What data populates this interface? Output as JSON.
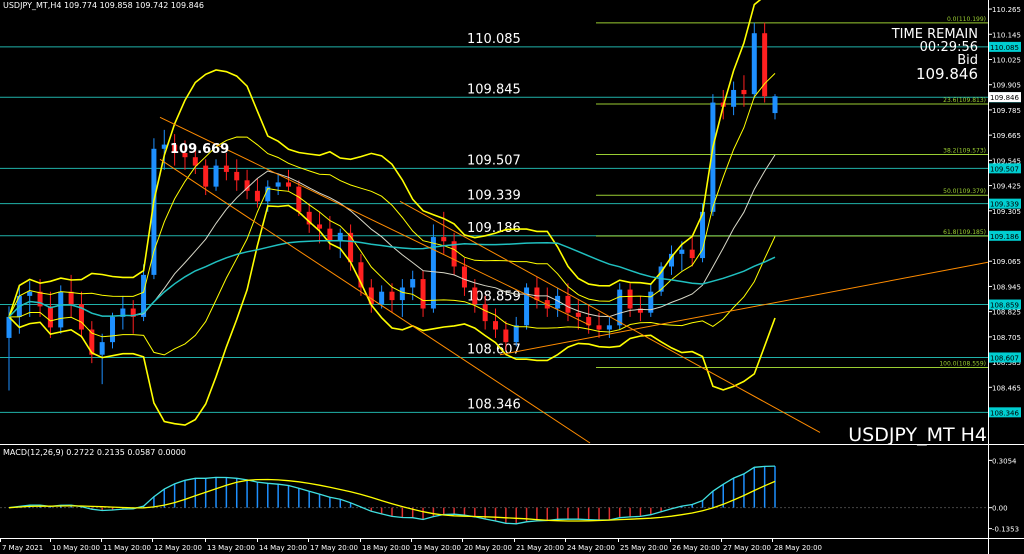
{
  "header": {
    "symbol_info": "USDJPY_MT,H4  109.774 109.858 109.742 109.846"
  },
  "overlay": {
    "time_remain_label": "TIME REMAIN",
    "time_remain_value": "00:29:56",
    "bid_label": "Bid",
    "bid_value": "109.846",
    "symbol_timeframe": "USDJPY_MT H4",
    "high_annotation": "109.669"
  },
  "macd": {
    "label": "MACD(12,26,9) 0.2722 0.2135 0.0587 0.0000",
    "axis_labels": [
      "0.3054",
      "0.00",
      "-0.1353"
    ],
    "axis_values": [
      0.3054,
      0.0,
      -0.1353
    ],
    "ylim": [
      -0.17,
      0.34
    ],
    "hist_color": "#1e90ff",
    "hist_neg_color": "#e03030",
    "signal_color": "#ffff00",
    "line_color": "#40e0e0"
  },
  "chart_data": {
    "type": "candlestick",
    "ylim": [
      108.2,
      110.27
    ],
    "price_axis_labels": [
      "110.265",
      "110.145",
      "110.025",
      "109.905",
      "109.785",
      "109.665",
      "109.545",
      "109.425",
      "109.305",
      "109.185",
      "109.065",
      "108.945",
      "108.825",
      "108.705",
      "108.585",
      "108.465",
      "108.345"
    ],
    "time_labels": [
      "7 May 2021",
      "10 May 20:00",
      "11 May 20:00",
      "12 May 20:00",
      "13 May 20:00",
      "14 May 20:00",
      "17 May 20:00",
      "18 May 20:00",
      "19 May 20:00",
      "20 May 20:00",
      "21 May 20:00",
      "24 May 20:00",
      "25 May 20:00",
      "26 May 20:00",
      "27 May 20:00",
      "28 May 20:00"
    ],
    "current_price": 109.846,
    "horizontal_levels": [
      {
        "label": "110.085",
        "value": 110.085
      },
      {
        "label": "109.845",
        "value": 109.845
      },
      {
        "label": "109.507",
        "value": 109.507
      },
      {
        "label": "109.339",
        "value": 109.339
      },
      {
        "label": "109.186",
        "value": 109.186
      },
      {
        "label": "108.859",
        "value": 108.859
      },
      {
        "label": "108.607",
        "value": 108.607
      },
      {
        "label": "108.346",
        "value": 108.346
      }
    ],
    "fibonacci": [
      {
        "label": "0.0(110.199)",
        "value": 110.199
      },
      {
        "label": "23.6(109.813)",
        "value": 109.813
      },
      {
        "label": "38.2(109.573)",
        "value": 109.573
      },
      {
        "label": "50.0(109.379)",
        "value": 109.379
      },
      {
        "label": "61.8(109.185)",
        "value": 109.185
      },
      {
        "label": "100.0(108.559)",
        "value": 108.559
      }
    ],
    "colors": {
      "bull": "#1e90ff",
      "bear": "#ff2020",
      "level_line": "#20b2aa",
      "level_tag_bg": "#00ced1",
      "fib": "#9acd32",
      "bollinger": "#ffff00",
      "ma": "#20c0c0",
      "trendline": "#ff8c00"
    },
    "candles": [
      [
        108.7,
        108.85,
        108.45,
        108.8
      ],
      [
        108.8,
        108.95,
        108.72,
        108.9
      ],
      [
        108.9,
        108.97,
        108.8,
        108.92
      ],
      [
        108.92,
        108.98,
        108.8,
        108.85
      ],
      [
        108.85,
        108.92,
        108.7,
        108.75
      ],
      [
        108.75,
        108.95,
        108.72,
        108.92
      ],
      [
        108.92,
        109.0,
        108.8,
        108.86
      ],
      [
        108.86,
        108.92,
        108.7,
        108.74
      ],
      [
        108.74,
        108.78,
        108.58,
        108.62
      ],
      [
        108.62,
        108.72,
        108.48,
        108.68
      ],
      [
        108.68,
        108.82,
        108.65,
        108.8
      ],
      [
        108.8,
        108.9,
        108.74,
        108.84
      ],
      [
        108.84,
        108.88,
        108.72,
        108.8
      ],
      [
        108.8,
        109.05,
        108.78,
        109.0
      ],
      [
        109.0,
        109.65,
        108.98,
        109.6
      ],
      [
        109.6,
        109.69,
        109.5,
        109.62
      ],
      [
        109.62,
        109.67,
        109.52,
        109.58
      ],
      [
        109.58,
        109.64,
        109.5,
        109.56
      ],
      [
        109.56,
        109.62,
        109.48,
        109.52
      ],
      [
        109.52,
        109.55,
        109.38,
        109.42
      ],
      [
        109.42,
        109.55,
        109.4,
        109.52
      ],
      [
        109.52,
        109.58,
        109.45,
        109.49
      ],
      [
        109.49,
        109.55,
        109.4,
        109.45
      ],
      [
        109.45,
        109.5,
        109.36,
        109.4
      ],
      [
        109.4,
        109.46,
        109.32,
        109.35
      ],
      [
        109.35,
        109.45,
        109.3,
        109.42
      ],
      [
        109.42,
        109.48,
        109.38,
        109.44
      ],
      [
        109.44,
        109.5,
        109.4,
        109.42
      ],
      [
        109.42,
        109.45,
        109.28,
        109.3
      ],
      [
        109.3,
        109.34,
        109.2,
        109.24
      ],
      [
        109.24,
        109.3,
        109.15,
        109.22
      ],
      [
        109.22,
        109.28,
        109.12,
        109.16
      ],
      [
        109.16,
        109.22,
        109.08,
        109.2
      ],
      [
        109.2,
        109.24,
        109.02,
        109.06
      ],
      [
        109.06,
        109.1,
        108.9,
        108.94
      ],
      [
        108.94,
        108.98,
        108.82,
        108.86
      ],
      [
        108.86,
        108.95,
        108.84,
        108.92
      ],
      [
        108.92,
        108.96,
        108.82,
        108.88
      ],
      [
        108.88,
        108.98,
        108.8,
        108.94
      ],
      [
        108.94,
        109.02,
        108.88,
        108.98
      ],
      [
        108.98,
        109.02,
        108.8,
        108.84
      ],
      [
        108.84,
        109.24,
        108.82,
        109.18
      ],
      [
        109.18,
        109.3,
        109.1,
        109.16
      ],
      [
        109.16,
        109.2,
        109.0,
        109.04
      ],
      [
        109.04,
        109.08,
        108.9,
        108.94
      ],
      [
        108.94,
        108.98,
        108.82,
        108.86
      ],
      [
        108.86,
        108.9,
        108.74,
        108.78
      ],
      [
        108.78,
        108.84,
        108.7,
        108.74
      ],
      [
        108.74,
        108.78,
        108.64,
        108.68
      ],
      [
        108.68,
        108.8,
        108.66,
        108.76
      ],
      [
        108.76,
        108.96,
        108.74,
        108.94
      ],
      [
        108.94,
        108.99,
        108.84,
        108.88
      ],
      [
        108.88,
        108.94,
        108.8,
        108.84
      ],
      [
        108.84,
        108.94,
        108.8,
        108.9
      ],
      [
        108.9,
        108.96,
        108.78,
        108.82
      ],
      [
        108.82,
        108.88,
        108.74,
        108.8
      ],
      [
        108.8,
        108.86,
        108.72,
        108.76
      ],
      [
        108.76,
        108.82,
        108.7,
        108.74
      ],
      [
        108.74,
        108.8,
        108.7,
        108.76
      ],
      [
        108.76,
        108.96,
        108.74,
        108.93
      ],
      [
        108.93,
        108.96,
        108.8,
        108.84
      ],
      [
        108.84,
        108.9,
        108.78,
        108.82
      ],
      [
        108.82,
        108.96,
        108.8,
        108.92
      ],
      [
        108.92,
        109.06,
        108.9,
        109.04
      ],
      [
        109.04,
        109.14,
        109.0,
        109.1
      ],
      [
        109.1,
        109.16,
        109.02,
        109.12
      ],
      [
        109.12,
        109.18,
        109.04,
        109.08
      ],
      [
        109.08,
        109.34,
        109.06,
        109.3
      ],
      [
        109.3,
        109.86,
        109.28,
        109.82
      ],
      [
        109.82,
        109.88,
        109.74,
        109.8
      ],
      [
        109.8,
        109.92,
        109.76,
        109.88
      ],
      [
        109.88,
        109.95,
        109.8,
        109.86
      ],
      [
        109.86,
        110.2,
        109.84,
        110.15
      ],
      [
        110.15,
        110.2,
        109.82,
        109.85
      ],
      [
        109.77,
        109.86,
        109.74,
        109.85
      ]
    ]
  }
}
